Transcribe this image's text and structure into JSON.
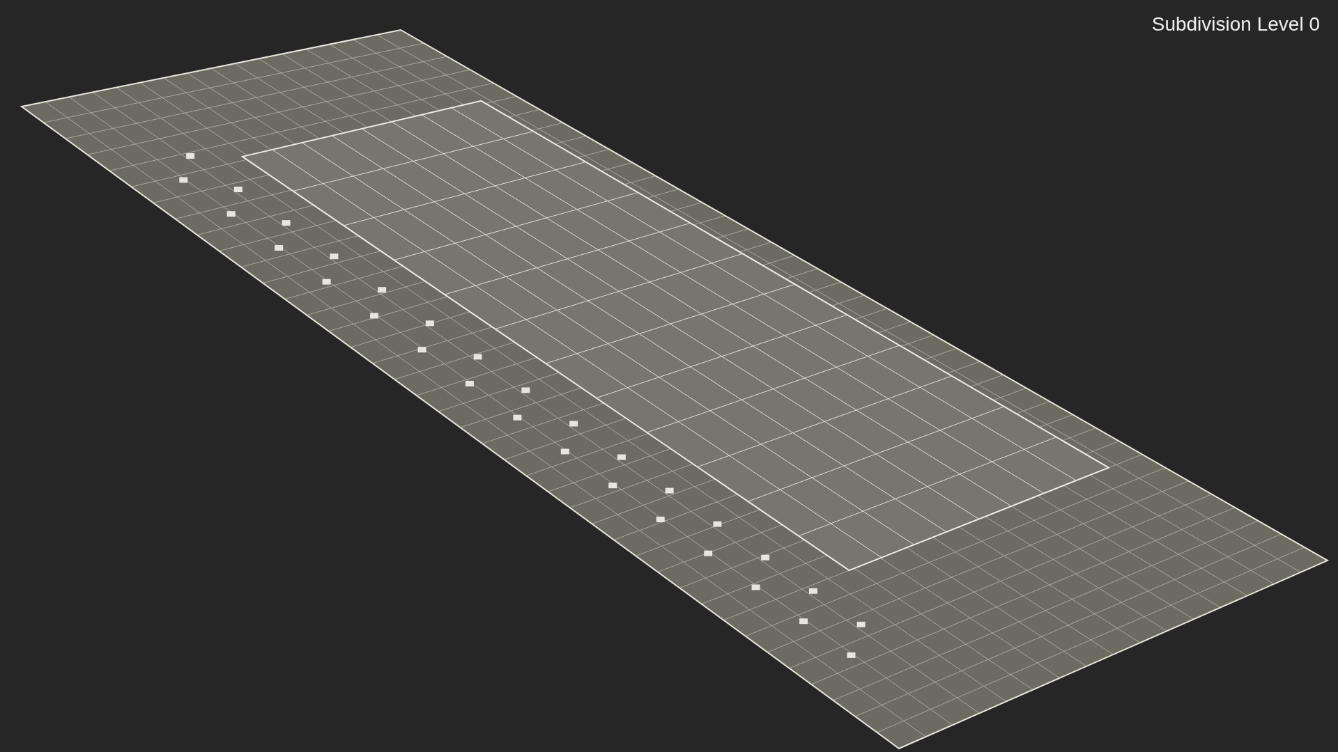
{
  "label": "Subdivision Level 0"
}
